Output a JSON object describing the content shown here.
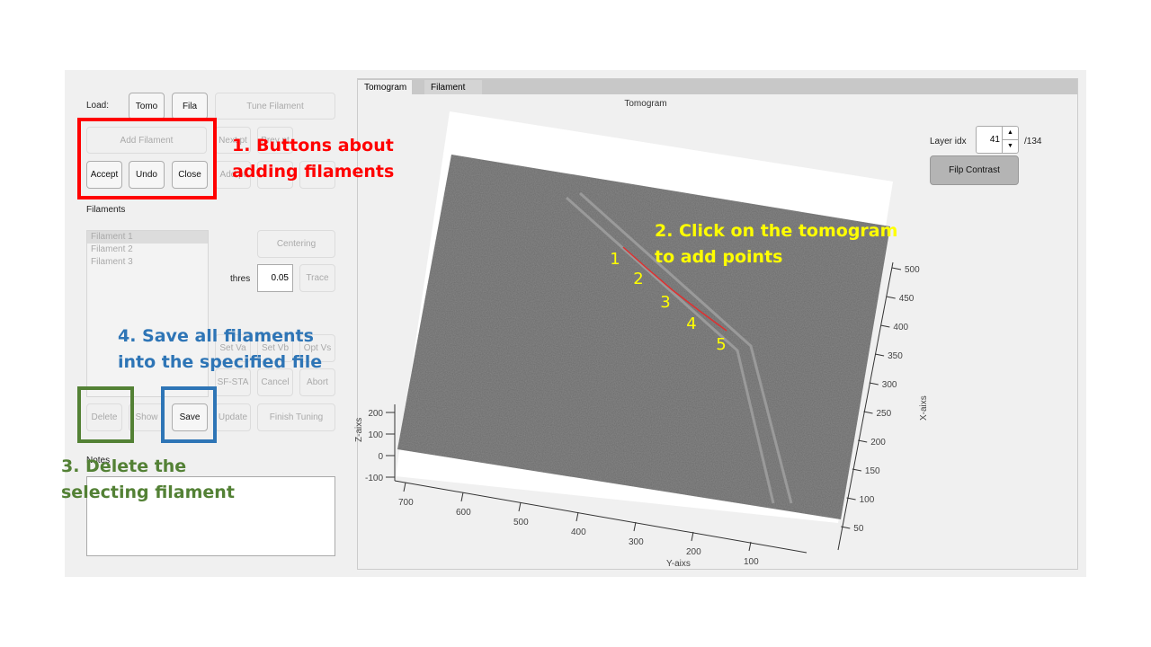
{
  "left_panel": {
    "load_label": "Load:",
    "tomo": "Tomo",
    "fila": "Fila",
    "tune_filament": "Tune Filament",
    "add_filament": "Add Filament",
    "next_pt": "Next pt",
    "prev_pt": "Prev pt",
    "accept": "Accept",
    "undo": "Undo",
    "close": "Close",
    "add_pt": "Add pt",
    "filaments_label": "Filaments",
    "filaments": [
      "Filament 1",
      "Filament 2",
      "Filament 3"
    ],
    "centering": "Centering",
    "thres_label": "thres",
    "thres_value": "0.05",
    "trace": "Trace",
    "set_va": "Set Va",
    "set_vb": "Set Vb",
    "opt_vs": "Opt Vs",
    "sf_sta": "SF-STA",
    "cancel": "Cancel",
    "abort": "Abort",
    "delete": "Delete",
    "show": "Show",
    "save": "Save",
    "update": "Update",
    "finish_tuning": "Finish Tuning",
    "notes_label": "Notes",
    "notes_value": ""
  },
  "tabs": [
    {
      "label": "Tomogram",
      "active": true
    },
    {
      "label": "Filament",
      "active": false
    }
  ],
  "plot": {
    "title": "Tomogram",
    "xlabel": "Y-aixs",
    "ylabel": "X-aixs",
    "zlabel": "Z-aixs",
    "y_ticks": [
      "700",
      "600",
      "500",
      "400",
      "300",
      "200",
      "100"
    ],
    "x_ticks": [
      "500",
      "450",
      "400",
      "350",
      "300",
      "250",
      "200",
      "150",
      "100",
      "50"
    ],
    "z_ticks": [
      "200",
      "100",
      "0",
      "-100"
    ],
    "points": [
      "1",
      "2",
      "3",
      "4",
      "5"
    ]
  },
  "layer": {
    "label": "Layer idx",
    "value": "41",
    "total": "/134",
    "flip_contrast": "Filp Contrast"
  },
  "annotations": {
    "a1": [
      "1. Buttons about",
      "adding filaments"
    ],
    "a2": [
      "2. Click on the tomogram",
      "to add points"
    ],
    "a3": [
      "3. Delete the",
      "selecting filament"
    ],
    "a4": [
      "4. Save all filaments",
      "into the specified file"
    ],
    "colors": {
      "a1": "#ff0000",
      "a2": "#ffff00",
      "a3": "#538135",
      "a4": "#2e75b6"
    }
  }
}
